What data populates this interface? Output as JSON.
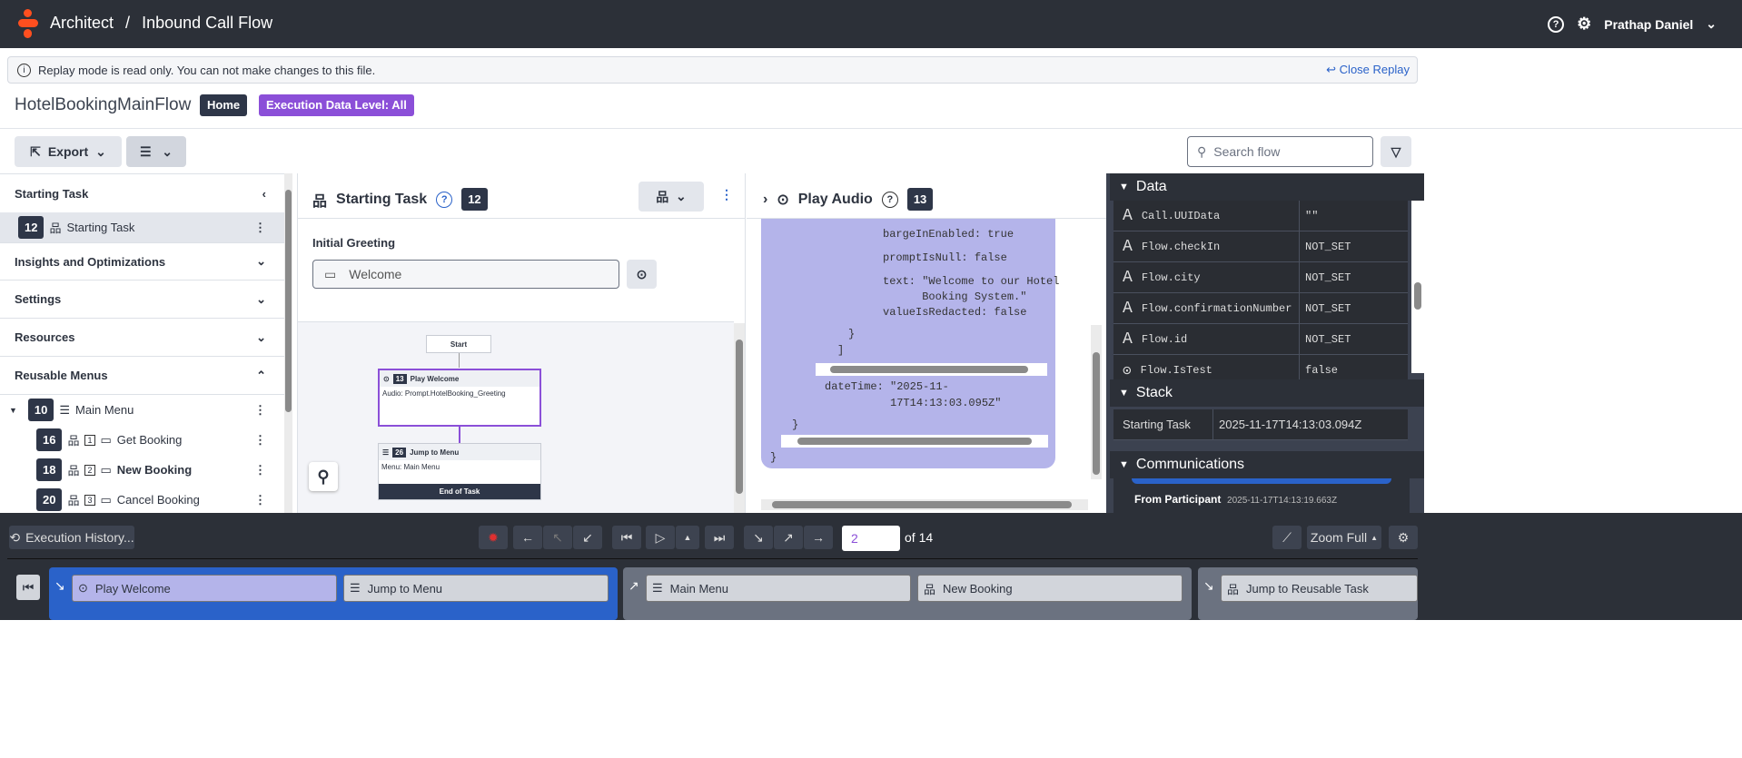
{
  "header": {
    "app": "Architect",
    "separator": "/",
    "flow": "Inbound Call Flow",
    "user": "Prathap Daniel"
  },
  "banner": {
    "message": "Replay mode is read only. You can not make changes to this file.",
    "close": "Close Replay"
  },
  "titlebar": {
    "flow_name": "HotelBookingMainFlow",
    "home": "Home",
    "level": "Execution Data Level: All"
  },
  "toolbar": {
    "export": "Export",
    "search_placeholder": "Search flow"
  },
  "nav": {
    "starting_task": "Starting Task",
    "task_num": "12",
    "task_label": "Starting Task",
    "insights": "Insights and Optimizations",
    "settings": "Settings",
    "resources": "Resources",
    "reusable_menus": "Reusable Menus",
    "main_menu": {
      "num": "10",
      "label": "Main Menu"
    },
    "children": [
      {
        "num": "16",
        "key": "1",
        "label": "Get Booking"
      },
      {
        "num": "18",
        "key": "2",
        "label": "New Booking"
      },
      {
        "num": "20",
        "key": "3",
        "label": "Cancel Booking"
      }
    ]
  },
  "middle": {
    "title": "Starting Task",
    "num": "12",
    "section": "Initial Greeting",
    "input": "Welcome",
    "canvas": {
      "start": "Start",
      "play_num": "13",
      "play_title": "Play Welcome",
      "play_body": "Audio: Prompt.HotelBooking_Greeting",
      "jump_num": "26",
      "jump_title": "Jump to Menu",
      "jump_body": "Menu: Main Menu",
      "end": "End of Task"
    }
  },
  "audio": {
    "title": "Play Audio",
    "num": "13",
    "lines": [
      "bargeInEnabled: true",
      "promptIsNull: false",
      "text: \"Welcome to our Hotel",
      "      Booking System.\"",
      "valueIsRedacted: false",
      "}",
      "]",
      "dateTime: \"2025-11-",
      "          17T14:13:03.095Z\"",
      "}",
      "}"
    ]
  },
  "data": {
    "title": "Data",
    "rows": [
      {
        "name": "Call.UUIData",
        "value": "\"\"",
        "icon": "A"
      },
      {
        "name": "Flow.checkIn",
        "value": "NOT_SET",
        "icon": "A"
      },
      {
        "name": "Flow.city",
        "value": "NOT_SET",
        "icon": "A"
      },
      {
        "name": "Flow.confirmationNumber",
        "value": "NOT_SET",
        "icon": "A"
      },
      {
        "name": "Flow.id",
        "value": "NOT_SET",
        "icon": "A"
      },
      {
        "name": "Flow.IsTest",
        "value": "false",
        "icon": "check"
      }
    ]
  },
  "stack": {
    "title": "Stack",
    "task": "Starting Task",
    "time": "2025-11-17T14:13:03.094Z"
  },
  "comms": {
    "title": "Communications",
    "from": "From Participant",
    "time": "2025-11-17T14:13:19.663Z"
  },
  "playback": {
    "history": "Execution History...",
    "step": "2",
    "of": "of 14",
    "zoom": "Zoom Full"
  },
  "timeline": [
    {
      "a": "Play Welcome",
      "b": "Jump to Menu"
    },
    {
      "a": "Main Menu",
      "b": "New Booking"
    },
    {
      "a": "Jump to Reusable Task"
    }
  ],
  "colors": {
    "accent": "#8b4fd8",
    "blue": "#2a62c9",
    "topbar": "#2c3038"
  }
}
